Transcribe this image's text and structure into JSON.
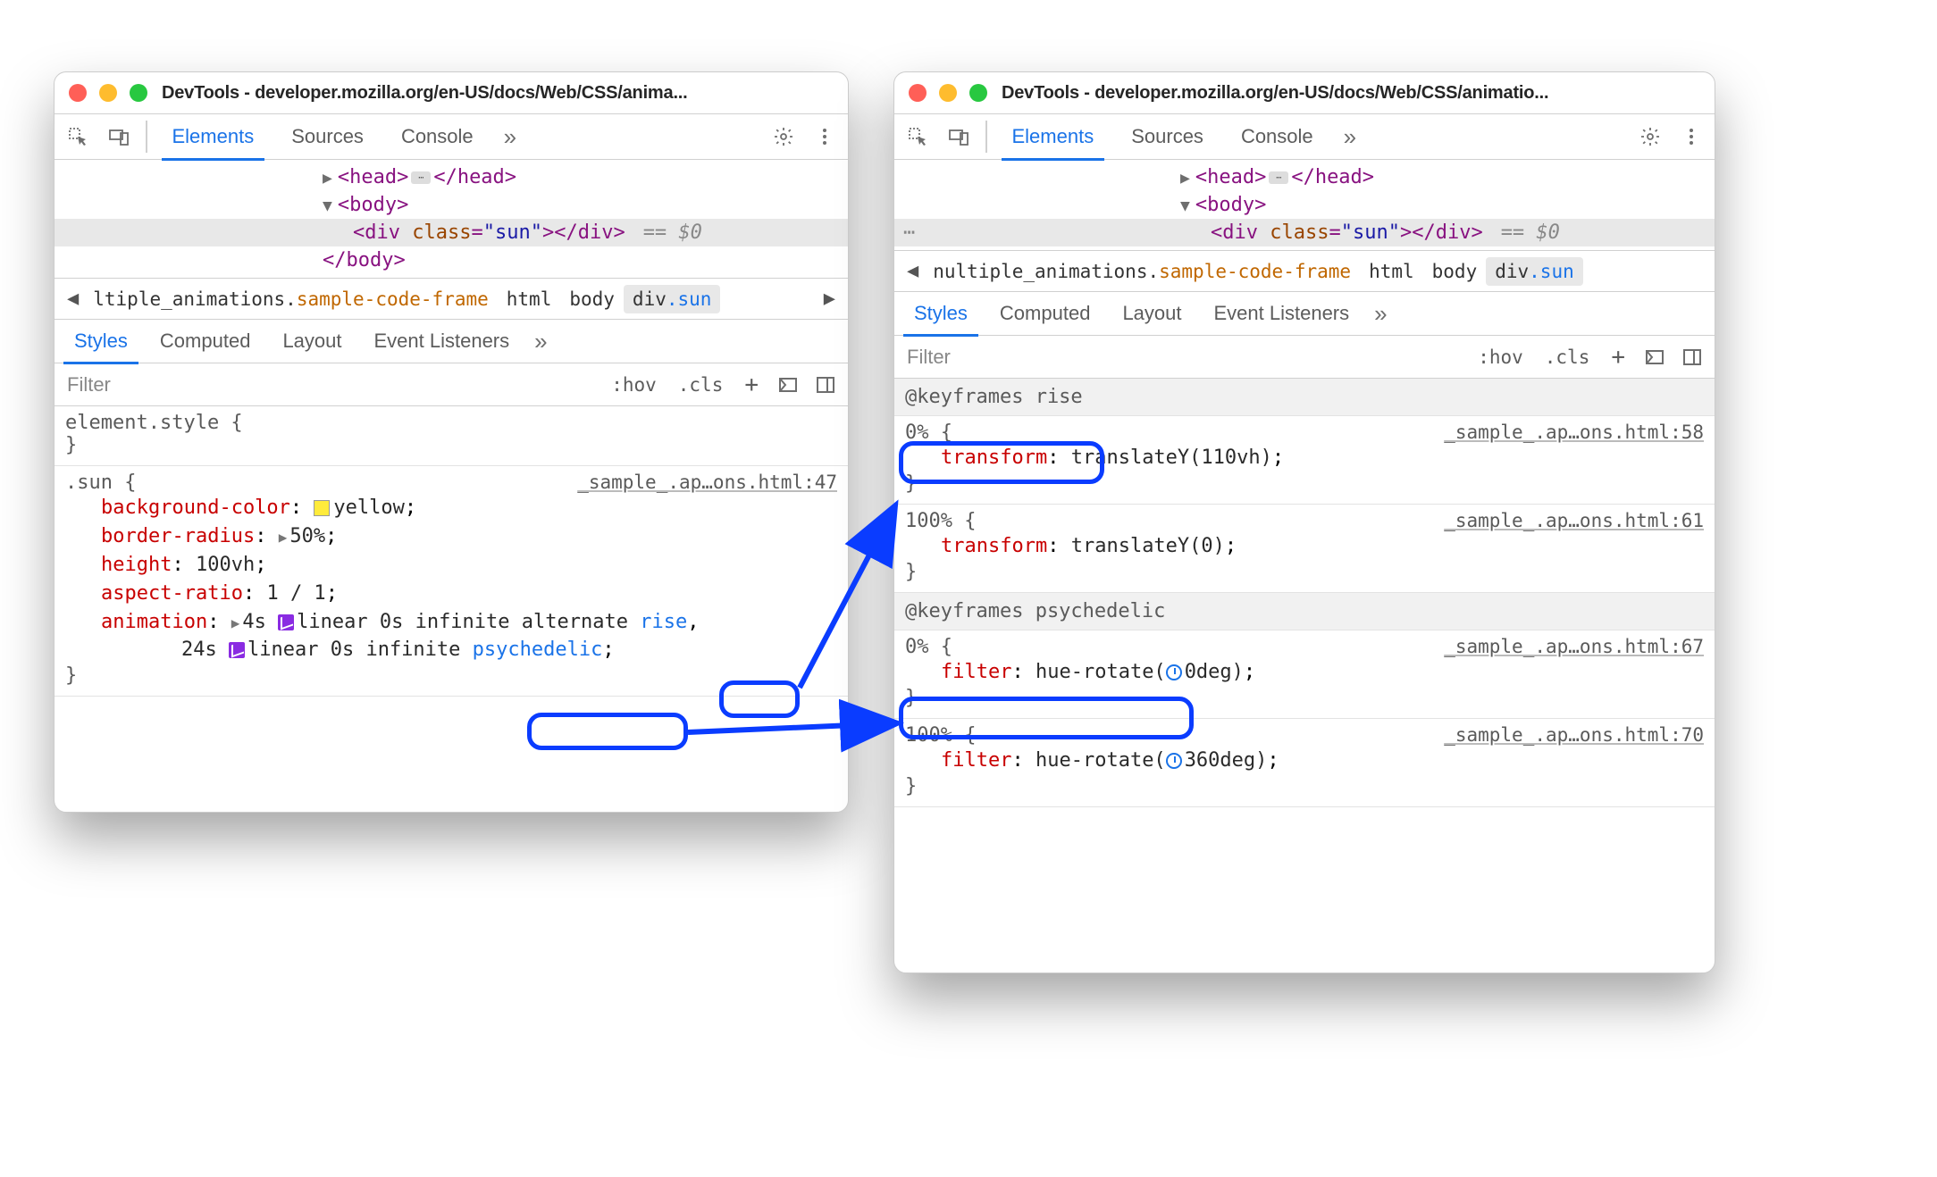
{
  "window_left": {
    "title": "DevTools - developer.mozilla.org/en-US/docs/Web/CSS/anima...",
    "tabs": {
      "elements": "Elements",
      "sources": "Sources",
      "console": "Console"
    },
    "dom": {
      "head": "<head>",
      "head_close": "</head>",
      "body_open": "<body>",
      "div_line_pre": "<",
      "div_tag": "div",
      "div_attr": "class",
      "div_val": "\"sun\"",
      "div_close": "></div>",
      "eq": "== $0",
      "body_close": "</body>"
    },
    "breadcrumb": {
      "iframe_pre": "ltiple_animations.",
      "iframe_frame": "sample-code-frame",
      "html": "html",
      "body": "body",
      "div": "div.sun"
    },
    "subtabs": {
      "styles": "Styles",
      "computed": "Computed",
      "layout": "Layout",
      "listeners": "Event Listeners"
    },
    "filter": {
      "placeholder": "Filter",
      "hov": ":hov",
      "cls": ".cls"
    },
    "element_style": {
      "selector": "element.style {"
    },
    "sun_rule": {
      "selector": ".sun {",
      "source": "_sample_.ap…ons.html:47",
      "bgc_prop": "background-color",
      "bgc_val": "yellow",
      "br_prop": "border-radius",
      "br_val": "50%",
      "h_prop": "height",
      "h_val": "100vh",
      "ar_prop": "aspect-ratio",
      "ar_val": "1 / 1",
      "anim_prop": "animation",
      "anim_val1_pre": "4s ",
      "anim_val1_easing": "linear",
      "anim_val1_rest": " 0s infinite alternate ",
      "anim_val1_name": "rise",
      "anim_val2_pre": "24s ",
      "anim_val2_easing": "linear",
      "anim_val2_rest": " 0s infinite ",
      "anim_val2_name": "psychedelic"
    }
  },
  "window_right": {
    "title": "DevTools - developer.mozilla.org/en-US/docs/Web/CSS/animatio...",
    "tabs": {
      "elements": "Elements",
      "sources": "Sources",
      "console": "Console"
    },
    "dom": {
      "head": "<head>",
      "head_close": "</head>",
      "body_open": "<body>",
      "div_tag": "div",
      "div_attr": "class",
      "div_val": "\"sun\"",
      "div_close": "></div>",
      "eq": "== $0"
    },
    "breadcrumb": {
      "iframe_pre": "nultiple_animations.",
      "iframe_frame": "sample-code-frame",
      "html": "html",
      "body": "body",
      "div": "div.sun"
    },
    "subtabs": {
      "styles": "Styles",
      "computed": "Computed",
      "layout": "Layout",
      "listeners": "Event Listeners"
    },
    "filter": {
      "placeholder": "Filter",
      "hov": ":hov",
      "cls": ".cls"
    },
    "kf_rise": {
      "header": "@keyframes rise",
      "f0_sel": "0% {",
      "f0_src": "_sample_.ap…ons.html:58",
      "f0_prop": "transform",
      "f0_val": "translateY(110vh)",
      "f100_sel": "100% {",
      "f100_src": "_sample_.ap…ons.html:61",
      "f100_prop": "transform",
      "f100_val": "translateY(0)"
    },
    "kf_psy": {
      "header": "@keyframes psychedelic",
      "f0_sel": "0% {",
      "f0_src": "_sample_.ap…ons.html:67",
      "f0_prop": "filter",
      "f0_val_pre": "hue-rotate(",
      "f0_val_deg": "0deg",
      "f0_val_post": ")",
      "f100_sel": "100% {",
      "f100_src": "_sample_.ap…ons.html:70",
      "f100_prop": "filter",
      "f100_val_pre": "hue-rotate(",
      "f100_val_deg": "360deg",
      "f100_val_post": ")"
    }
  }
}
